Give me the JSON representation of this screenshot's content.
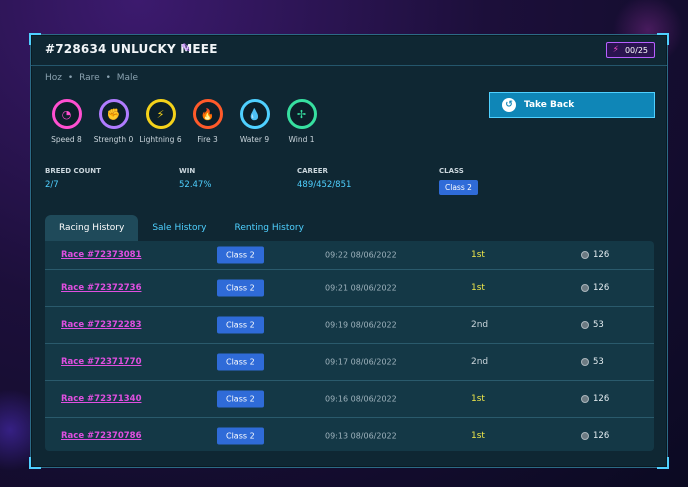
{
  "title": "#728634 UNLUCKY MEEE",
  "energy": "00/25",
  "meta": [
    "Hoz",
    "Rare",
    "Male"
  ],
  "take_back": "Take Back",
  "stats": [
    {
      "label": "Speed 8",
      "color": "#ff4fd0",
      "icon": "speedometer-icon"
    },
    {
      "label": "Strength 0",
      "color": "#b07cff",
      "icon": "fist-icon"
    },
    {
      "label": "Lightning 6",
      "color": "#f5d21a",
      "icon": "lightning-icon"
    },
    {
      "label": "Fire 3",
      "color": "#ff5a2a",
      "icon": "fire-icon"
    },
    {
      "label": "Water 9",
      "color": "#4fd0ff",
      "icon": "water-drop-icon"
    },
    {
      "label": "Wind 1",
      "color": "#37e0a0",
      "icon": "wind-icon"
    }
  ],
  "info": {
    "breed_label": "BREED COUNT",
    "breed_value": "2/7",
    "win_label": "WIN",
    "win_value": "52.47%",
    "career_label": "CAREER",
    "career_value": "489/452/851",
    "class_label": "CLASS",
    "class_value": "Class 2"
  },
  "tabs": [
    "Racing History",
    "Sale History",
    "Renting History"
  ],
  "rows": [
    {
      "race": "Race #72373081",
      "class": "Class 2",
      "time": "09:22 08/06/2022",
      "place": "1st",
      "prize": "126"
    },
    {
      "race": "Race #72372736",
      "class": "Class 2",
      "time": "09:21 08/06/2022",
      "place": "1st",
      "prize": "126"
    },
    {
      "race": "Race #72372283",
      "class": "Class 2",
      "time": "09:19 08/06/2022",
      "place": "2nd",
      "prize": "53"
    },
    {
      "race": "Race #72371770",
      "class": "Class 2",
      "time": "09:17 08/06/2022",
      "place": "2nd",
      "prize": "53"
    },
    {
      "race": "Race #72371340",
      "class": "Class 2",
      "time": "09:16 08/06/2022",
      "place": "1st",
      "prize": "126"
    },
    {
      "race": "Race #72370786",
      "class": "Class 2",
      "time": "09:13 08/06/2022",
      "place": "1st",
      "prize": "126"
    }
  ]
}
